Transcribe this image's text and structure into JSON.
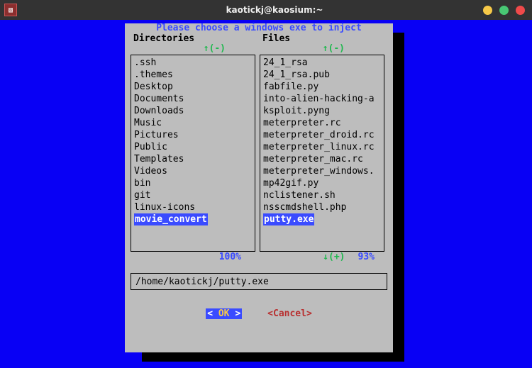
{
  "window": {
    "title": "kaotickj@kaosium:~"
  },
  "dialog": {
    "title": "Please choose a windows exe to inject",
    "dir_header": "Directories",
    "files_header": "Files",
    "top_indicator": "↑(-)",
    "bottom_indicator": "↓(+)",
    "dir_pct": "100%",
    "files_pct": "93%",
    "path_value": "/home/kaotickj/putty.exe",
    "ok_label": "OK",
    "cancel_label": "Cancel"
  },
  "directories": [
    ".ssh",
    ".themes",
    "Desktop",
    "Documents",
    "Downloads",
    "Music",
    "Pictures",
    "Public",
    "Templates",
    "Videos",
    "bin",
    "git",
    "linux-icons",
    "movie_convert"
  ],
  "dir_selected": "movie_convert",
  "files": [
    "24_1_rsa",
    "24_1_rsa.pub",
    "fabfile.py",
    "into-alien-hacking-a",
    "ksploit.pyng",
    "meterpreter.rc",
    "meterpreter_droid.rc",
    "meterpreter_linux.rc",
    "meterpreter_mac.rc",
    "meterpreter_windows.",
    "mp42gif.py",
    "nclistener.sh",
    "nsscmdshell.php",
    "putty.exe"
  ],
  "file_selected": "putty.exe"
}
